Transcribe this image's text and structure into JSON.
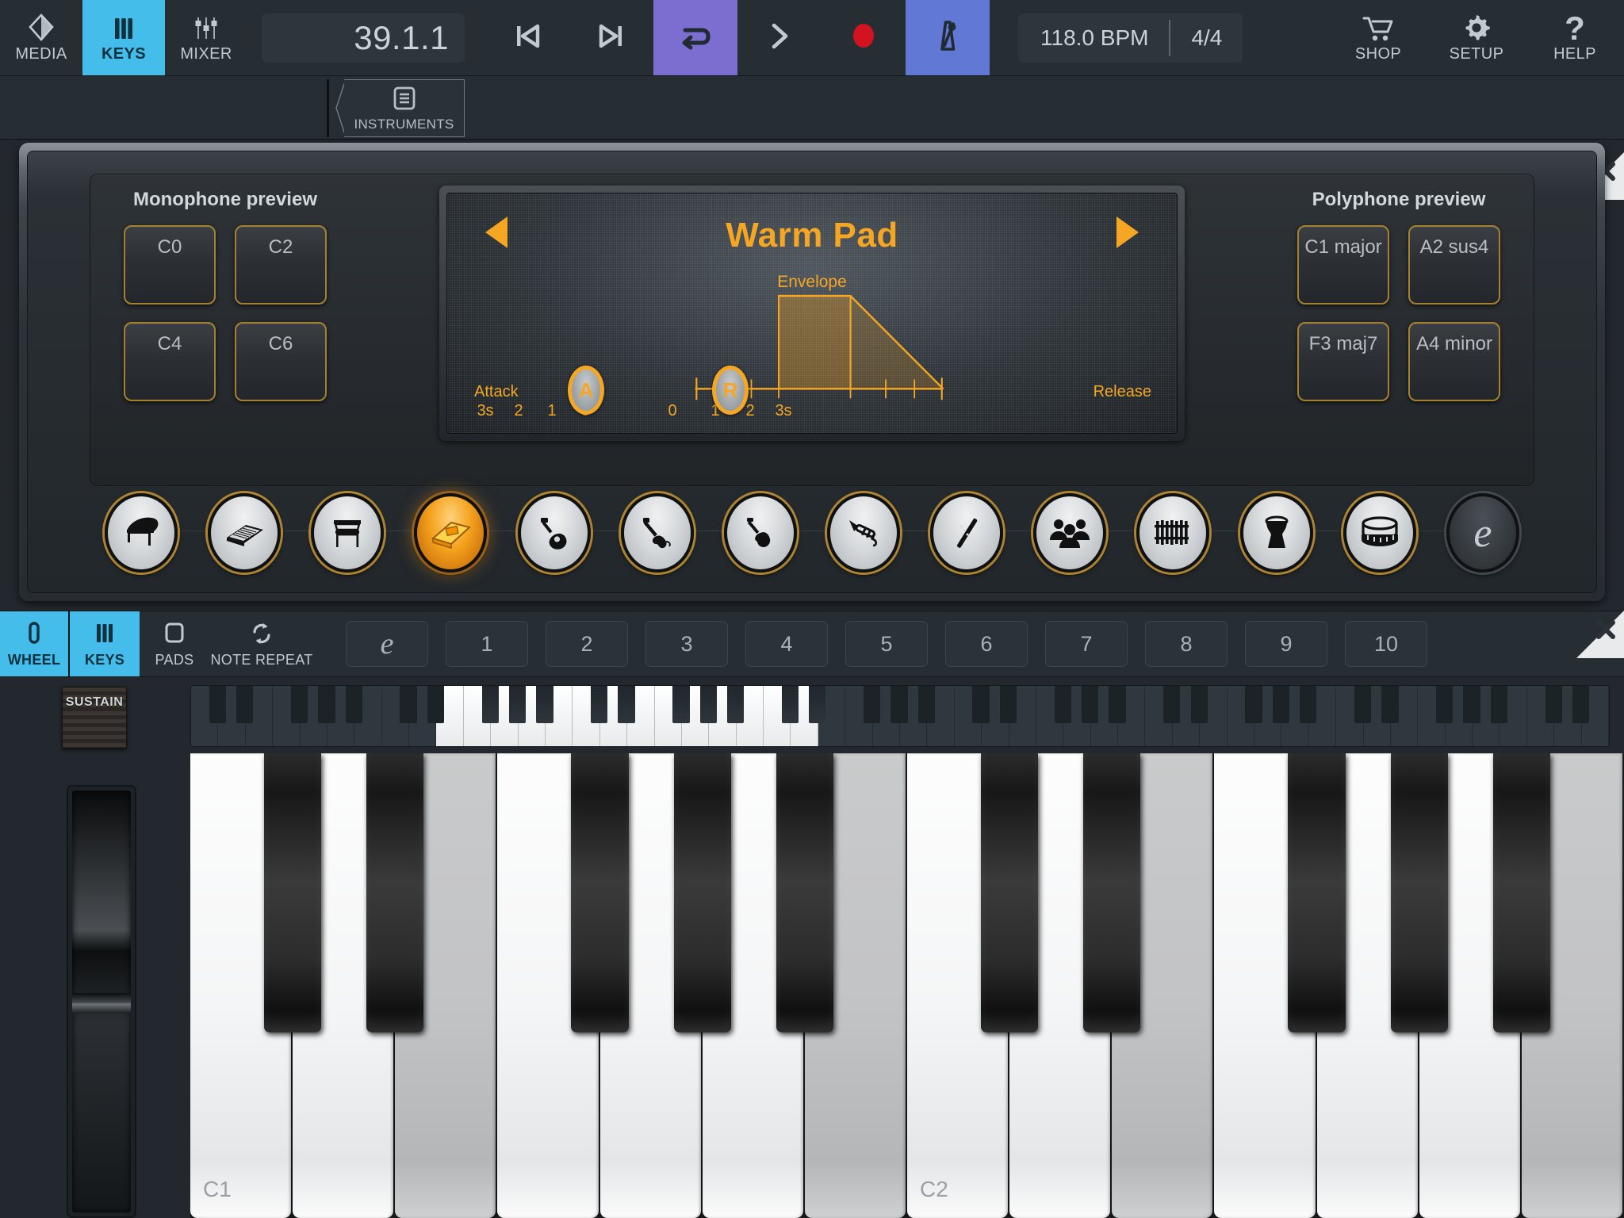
{
  "topbar": {
    "nav": [
      {
        "label": "MEDIA",
        "icon": "media-diamond-icon",
        "active": false
      },
      {
        "label": "KEYS",
        "icon": "keys-icon",
        "active": true
      },
      {
        "label": "MIXER",
        "icon": "mixer-faders-icon",
        "active": false
      }
    ],
    "position": "39.1.1",
    "transport": [
      {
        "name": "rewind-to-start",
        "icon": "skip-back-icon",
        "state": "off"
      },
      {
        "name": "forward-to-end",
        "icon": "skip-forward-icon",
        "state": "off"
      },
      {
        "name": "loop",
        "icon": "loop-icon",
        "state": "on"
      },
      {
        "name": "play",
        "icon": "play-icon",
        "state": "off"
      },
      {
        "name": "record",
        "icon": "record-icon",
        "state": "off"
      },
      {
        "name": "metronome",
        "icon": "metronome-icon",
        "state": "on"
      }
    ],
    "tempo": "118.0 BPM",
    "time_signature": "4/4",
    "right": [
      {
        "label": "SHOP",
        "icon": "cart-icon"
      },
      {
        "label": "SETUP",
        "icon": "gear-icon"
      },
      {
        "label": "HELP",
        "icon": "question-icon"
      }
    ]
  },
  "tabstrip": {
    "instruments_label": "INSTRUMENTS",
    "instruments_icon": "list-document-icon",
    "close_label": "✖"
  },
  "panel": {
    "mono": {
      "title": "Monophone preview",
      "pads": [
        "C0",
        "C2",
        "C4",
        "C6"
      ]
    },
    "poly": {
      "title": "Polyphone preview",
      "pads": [
        "C1 major",
        "A2 sus4",
        "F3 maj7",
        "A4 minor"
      ]
    },
    "lcd": {
      "preset_name": "Warm Pad",
      "prev_icon": "arrow-left-icon",
      "next_icon": "arrow-right-icon",
      "envelope_label": "Envelope",
      "attack_label": "Attack",
      "release_label": "Release",
      "attack_handle": "A",
      "release_handle": "R",
      "attack_ticks": [
        "3s",
        "2",
        "1",
        "0"
      ],
      "release_ticks": [
        "0",
        "1",
        "2",
        "3s"
      ],
      "accent_color": "#f5a623"
    },
    "instruments": [
      {
        "name": "grand-piano",
        "icon": "grand-piano-icon",
        "active": false
      },
      {
        "name": "synth-keyboard",
        "icon": "synth-keyboard-icon",
        "active": false
      },
      {
        "name": "upright-piano",
        "icon": "upright-piano-icon",
        "active": false
      },
      {
        "name": "organ-synth",
        "icon": "organ-synth-icon",
        "active": true
      },
      {
        "name": "acoustic-guitar",
        "icon": "acoustic-guitar-icon",
        "active": false
      },
      {
        "name": "electric-bass",
        "icon": "electric-bass-icon",
        "active": false
      },
      {
        "name": "violin",
        "icon": "violin-icon",
        "active": false
      },
      {
        "name": "trumpet",
        "icon": "trumpet-icon",
        "active": false
      },
      {
        "name": "flute",
        "icon": "flute-icon",
        "active": false
      },
      {
        "name": "choir",
        "icon": "choir-icon",
        "active": false
      },
      {
        "name": "xylophone",
        "icon": "xylophone-icon",
        "active": false
      },
      {
        "name": "djembe",
        "icon": "djembe-icon",
        "active": false
      },
      {
        "name": "snare-drum",
        "icon": "snare-drum-icon",
        "active": false
      },
      {
        "name": "edit",
        "icon": "edit-e-icon",
        "active": false
      }
    ]
  },
  "keysbar": {
    "modes": [
      {
        "label": "WHEEL",
        "icon": "wheel-icon",
        "active": true
      },
      {
        "label": "KEYS",
        "icon": "keys-icon",
        "active": true
      },
      {
        "label": "PADS",
        "icon": "pads-square-icon",
        "active": false
      },
      {
        "label": "NOTE REPEAT",
        "icon": "note-repeat-icon",
        "active": false
      }
    ],
    "edit_label": "e",
    "octaves": [
      "1",
      "2",
      "3",
      "4",
      "5",
      "6",
      "7",
      "8",
      "9",
      "10"
    ],
    "close_label": "✖"
  },
  "keyboard": {
    "sustain_label": "SUSTAIN",
    "key_labels": [
      "C1",
      "C2"
    ],
    "mod_wheel_name": "modulation-wheel"
  },
  "colors": {
    "accent_blue": "#45bdea",
    "accent_orange": "#f5a623",
    "loop_purple": "#7b6ed0",
    "metro_blue": "#6179d4",
    "record_red": "#d41320",
    "panel_dark": "#22282d"
  }
}
